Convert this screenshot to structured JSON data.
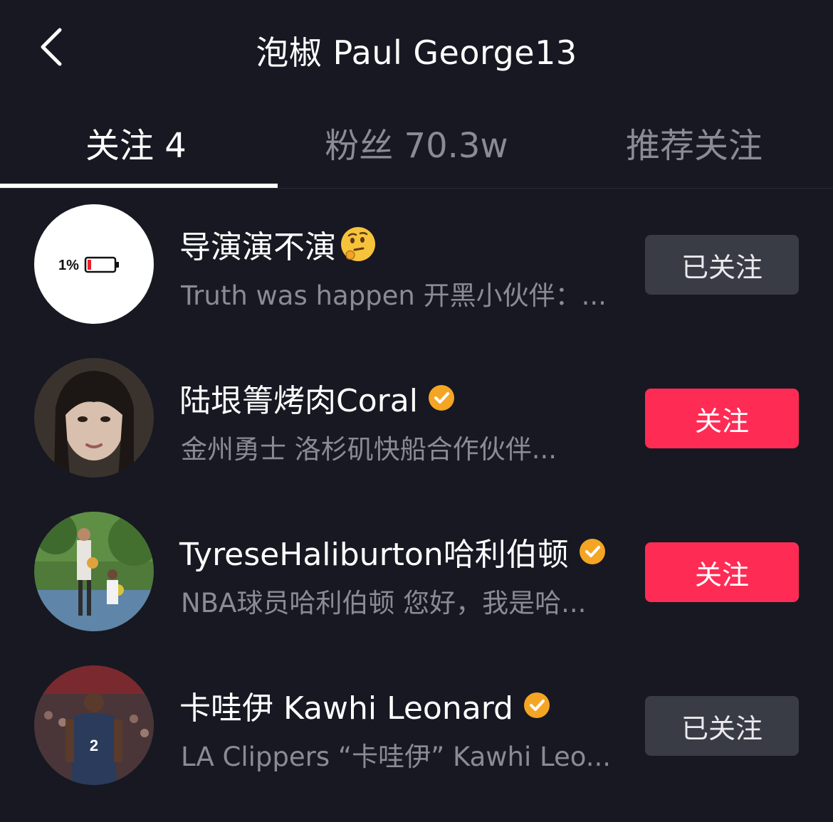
{
  "header": {
    "title": "泡椒 Paul George13"
  },
  "tabs": [
    {
      "label": "关注 4",
      "active": true
    },
    {
      "label": "粉丝 70.3w",
      "active": false
    },
    {
      "label": "推荐关注",
      "active": false
    }
  ],
  "avatar_battery": {
    "text": "1%"
  },
  "users": [
    {
      "name": "导演演不演",
      "verified": false,
      "emoji": "thinking-face",
      "desc": "Truth was happen  开黑小伙伴：...",
      "button": "已关注",
      "button_state": "followed"
    },
    {
      "name": "陆垠箐烤肉Coral",
      "verified": true,
      "desc": "金州勇士 洛杉矶快船合作伙伴...",
      "button": "关注",
      "button_state": "follow"
    },
    {
      "name": "TyreseHaliburton哈利伯顿",
      "verified": true,
      "desc": "NBA球员哈利伯顿 您好，我是哈...",
      "button": "关注",
      "button_state": "follow"
    },
    {
      "name": "卡哇伊 Kawhi Leonard",
      "verified": true,
      "desc": "LA Clippers “卡哇伊” Kawhi Leo...",
      "button": "已关注",
      "button_state": "followed"
    }
  ],
  "colors": {
    "background": "#171822",
    "follow_button": "#fe2c55",
    "followed_button": "#393b45",
    "verified_badge": "#f5a524",
    "secondary_text": "#8a8b93"
  }
}
